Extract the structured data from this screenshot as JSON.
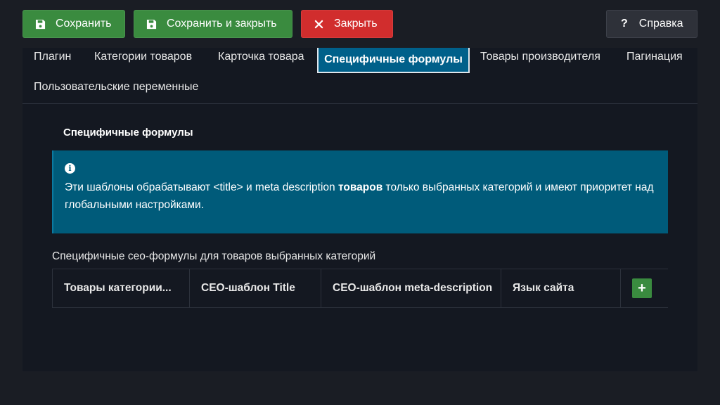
{
  "toolbar": {
    "save_label": "Сохранить",
    "save_close_label": "Сохранить и закрыть",
    "close_label": "Закрыть",
    "help_label": "Справка",
    "help_glyph": "?"
  },
  "tabs": [
    {
      "label": "Плагин"
    },
    {
      "label": "Категории товаров"
    },
    {
      "label": "Карточка товара"
    },
    {
      "label": "Специфичные формулы",
      "active": true
    },
    {
      "label": "Товары производителя"
    },
    {
      "label": "Пагинация"
    },
    {
      "label": "Пользовательские переменные"
    }
  ],
  "section": {
    "title": "Специфичные формулы"
  },
  "info": {
    "text_before": "Эти шаблоны обрабатывают <title> и meta description ",
    "text_bold": "товаров",
    "text_after": " только выбранных категорий и имеют приоритет над глобальными настройками."
  },
  "table": {
    "caption": "Специфичные сео-формулы для товаров выбранных категорий",
    "headers": [
      "Товары категории...",
      "СЕО-шаблон Title",
      "СЕО-шаблон meta-description",
      "Язык сайта"
    ],
    "add_glyph": "+"
  },
  "colors": {
    "success": "#3a8b3f",
    "danger": "#d12d2d",
    "info": "#005b7a",
    "active_tab": "#00608a",
    "background": "#1a1d24",
    "panel": "#141821"
  },
  "icons": {
    "save": "floppy-disk-icon",
    "close": "x-icon",
    "help": "question-icon",
    "info": "info-circle-icon",
    "add": "plus-icon"
  }
}
